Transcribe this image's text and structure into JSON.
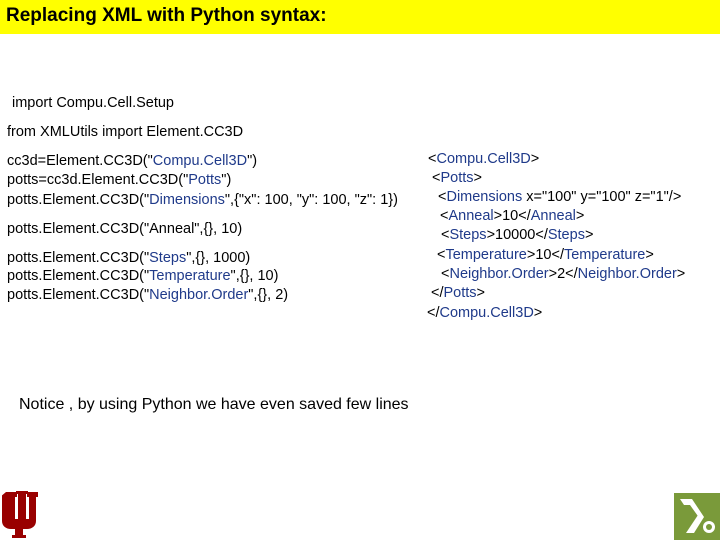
{
  "title": "Replacing XML with Python syntax:",
  "left_code": {
    "line1": "import Compu.Cell.Setup",
    "line2": "from XMLUtils import Element.CC3D",
    "line3": {
      "a": "cc3d=Element.CC3D(\"",
      "b": "Compu.Cell3D",
      "c": "\")"
    },
    "line4": {
      "a": "potts=cc3d.Element.CC3D(\"",
      "b": "Potts",
      "c": "\")"
    },
    "line5": {
      "a": "potts.Element.CC3D(\"",
      "b": "Dimensions",
      "c": "\",{\"x\": 100, \"y\": 100, \"z\": 1})"
    },
    "line6": "potts.Element.CC3D(\"Anneal\",{}, 10)",
    "line7": {
      "a": "potts.Element.CC3D(\"",
      "b": "Steps",
      "c": "\",{}, 1000)"
    },
    "line8": {
      "a": "potts.Element.CC3D(\"",
      "b": "Temperature",
      "c": "\",{}, 10)"
    },
    "line9": {
      "a": "potts.Element.CC3D(\"",
      "b": "Neighbor.Order",
      "c": "\",{}, 2)"
    }
  },
  "xml_code": {
    "x1": {
      "a": "<",
      "b": "Compu.Cell3D",
      "c": ">"
    },
    "x2": {
      "a": "<",
      "b": "Potts",
      "c": ">"
    },
    "x3": {
      "a": "<",
      "b": "Dimensions",
      "c": " x=\"100\" y=\"100\" z=\"1\"/>"
    },
    "x4": {
      "a": "<",
      "b": "Anneal",
      "c": ">10</",
      "d": "Anneal",
      "e": ">"
    },
    "x5": {
      "a": "<",
      "b": "Steps",
      "c": ">10000</",
      "d": "Steps",
      "e": ">"
    },
    "x6": {
      "a": "<",
      "b": "Temperature",
      "c": ">10</",
      "d": "Temperature",
      "e": ">"
    },
    "x7": {
      "a": "<",
      "b": "Neighbor.Order",
      "c": ">2</",
      "d": "Neighbor.Order",
      "e": ">"
    },
    "x8": {
      "a": "</",
      "b": "Potts",
      "c": ">"
    },
    "x9": {
      "a": "</",
      "b": "Compu.Cell3D",
      "c": ">"
    }
  },
  "notice": "Notice , by using Python we have even saved few lines",
  "colors": {
    "title_bg": "#ffff00",
    "keyword": "#1f3a8a"
  },
  "logos": [
    "indiana-university-trident-logo",
    "green-corner-logo"
  ]
}
